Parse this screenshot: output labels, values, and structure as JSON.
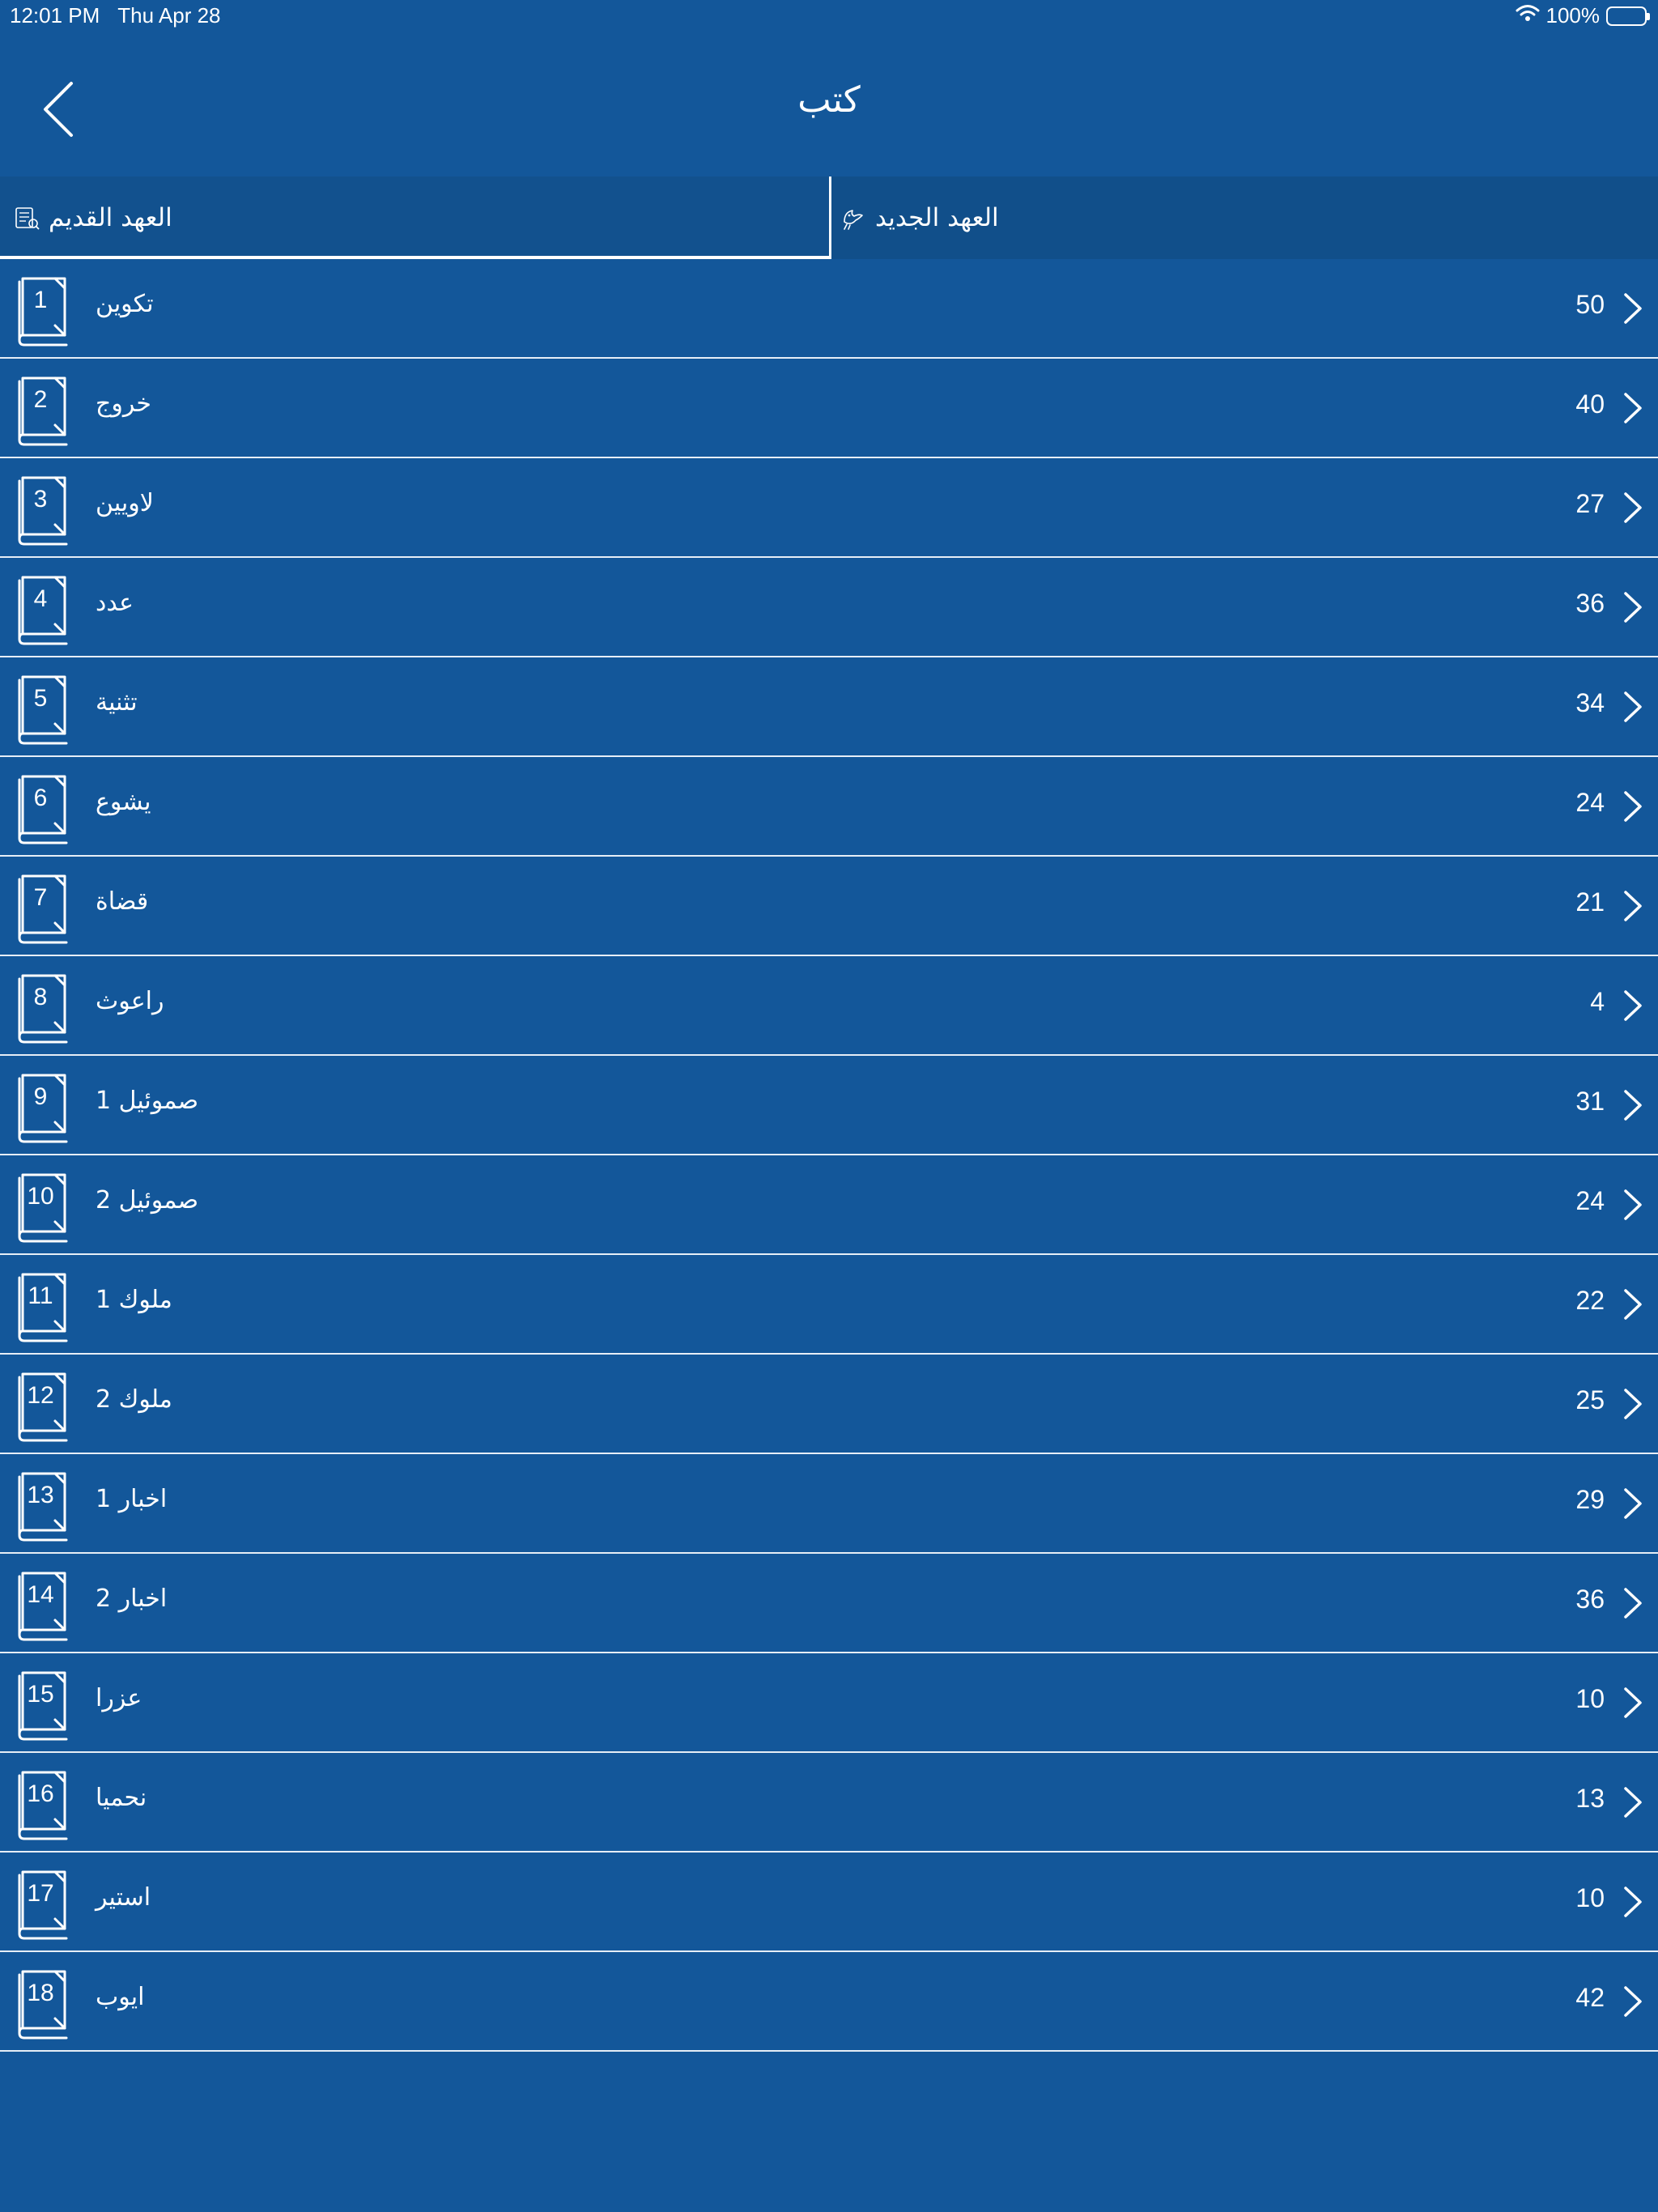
{
  "status_bar": {
    "time": "12:01 PM",
    "date": "Thu Apr 28",
    "battery": "100%"
  },
  "nav": {
    "title": "کتب"
  },
  "tabs": [
    {
      "label": "العهد القديم",
      "selected": true
    },
    {
      "label": "العهد الجديد",
      "selected": false
    }
  ],
  "books": [
    {
      "num": "1",
      "name": "تکوین",
      "chapters": "50"
    },
    {
      "num": "2",
      "name": "خروج",
      "chapters": "40"
    },
    {
      "num": "3",
      "name": "لاویین",
      "chapters": "27"
    },
    {
      "num": "4",
      "name": "عدد",
      "chapters": "36"
    },
    {
      "num": "5",
      "name": "تثنیة",
      "chapters": "34"
    },
    {
      "num": "6",
      "name": "یشوع",
      "chapters": "24"
    },
    {
      "num": "7",
      "name": "قضاة",
      "chapters": "21"
    },
    {
      "num": "8",
      "name": "راعوث",
      "chapters": "4"
    },
    {
      "num": "9",
      "name": "1 صموئیل",
      "chapters": "31"
    },
    {
      "num": "10",
      "name": "2 صموئیل",
      "chapters": "24"
    },
    {
      "num": "11",
      "name": "1 ملوك",
      "chapters": "22"
    },
    {
      "num": "12",
      "name": "2 ملوك",
      "chapters": "25"
    },
    {
      "num": "13",
      "name": "1 اخبار",
      "chapters": "29"
    },
    {
      "num": "14",
      "name": "2 اخبار",
      "chapters": "36"
    },
    {
      "num": "15",
      "name": "عزرا",
      "chapters": "10"
    },
    {
      "num": "16",
      "name": "نحمیا",
      "chapters": "13"
    },
    {
      "num": "17",
      "name": "استیر",
      "chapters": "10"
    },
    {
      "num": "18",
      "name": "ایوب",
      "chapters": "42"
    }
  ]
}
